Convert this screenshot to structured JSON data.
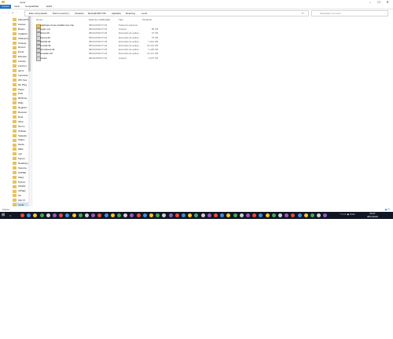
{
  "window": {
    "title": "ovute",
    "minimize": "–",
    "maximize": "☐",
    "close": "✕"
  },
  "ribbon": {
    "tabs": [
      "Arquivo",
      "Início",
      "Compartilhar",
      "Exibir"
    ]
  },
  "address": {
    "back": "←",
    "forward": "→",
    "up_dropdown": "∨",
    "up": "↑",
    "breadcrumbs": [
      "Este Computador",
      "Disco Local (C:)",
      "Usuários",
      "ReinaldoRH7720",
      "AppData",
      "Roaming",
      "ovute"
    ],
    "refresh": "↻",
    "search_placeholder": "Pesquisar em ovute"
  },
  "sidebar": {
    "items": [
      "ZebraGT800",
      "Acesso",
      "Books",
      "Cadastro",
      "CMscanner",
      "Change",
      "Drivers",
      "Excel",
      "Estoque",
      "FontAp",
      "FontCol",
      "game",
      "Impressa",
      "IPC Sca",
      "ML Plug",
      "Papel",
      "Peal",
      "RFID Ap",
      "Rally",
      "Registro",
      "Respost",
      "Rota",
      "Silva",
      "Sincro",
      "Softwar",
      "Solando",
      "Status",
      "Muda",
      "MRC",
      "mpt",
      "Mycon",
      "ReadApp",
      "Sesame",
      "SAPRE",
      "Sales",
      "Python",
      "UltraDr",
      "UlPage",
      "Git",
      "App Cl",
      "ovute"
    ],
    "selected": "ovute"
  },
  "columns": {
    "name": "Nome",
    "date": "Data de modificação",
    "type": "Tipo",
    "size": "Tamanho"
  },
  "files": [
    {
      "name": "gxkjhsqw.ovute-installer.exe.tmp",
      "date": "08/11/2018 07:29",
      "type": "Pasta de arquivos",
      "size": "",
      "folder": true
    },
    {
      "name": "lystgz.xyz",
      "date": "08/11/2018 07:29",
      "type": "Arquivo",
      "size": "86 KB",
      "folder": false
    },
    {
      "name": "libcurl.dll",
      "date": "08/11/2018 07:29",
      "type": "Extensão de aplica...",
      "size": "37 KB",
      "folder": false
    },
    {
      "name": "libemd.dll",
      "date": "08/11/2018 07:29",
      "type": "Extensão de aplica...",
      "size": "75 KB",
      "folder": false
    },
    {
      "name": "libwhld.dll",
      "date": "08/11/2018 07:29",
      "type": "Extensão de aplica...",
      "size": "1.014 KB",
      "folder": false
    },
    {
      "name": "lmtoolk.dll",
      "date": "08/11/2018 07:29",
      "type": "Extensão de aplica...",
      "size": "10.241 KB",
      "folder": false
    },
    {
      "name": "ubxmlsecd.dll",
      "date": "08/11/2018 07:29",
      "type": "Extensão de aplica...",
      "size": "1.425 KB",
      "folder": false
    },
    {
      "name": "wimadec.dll",
      "date": "08/11/2018 07:29",
      "type": "Extensão de aplica...",
      "size": "14.471 KB",
      "folder": false
    },
    {
      "name": "ovutex",
      "date": "08/11/2018 07:29",
      "type": "Arquivo",
      "size": "2.027 KB",
      "folder": false
    }
  ],
  "status": {
    "items_count": "9 itens"
  },
  "taskbar": {
    "start": "⊞",
    "search": "○",
    "tray_text": "^ ⊡ ⊡ ◀) POR",
    "time": "09:47",
    "date": "08/11/2018",
    "app_colors": [
      "#e84b3c",
      "#3f8de0",
      "#f5c431",
      "#40a956",
      "#d0d0d0",
      "#9b59b6"
    ]
  }
}
